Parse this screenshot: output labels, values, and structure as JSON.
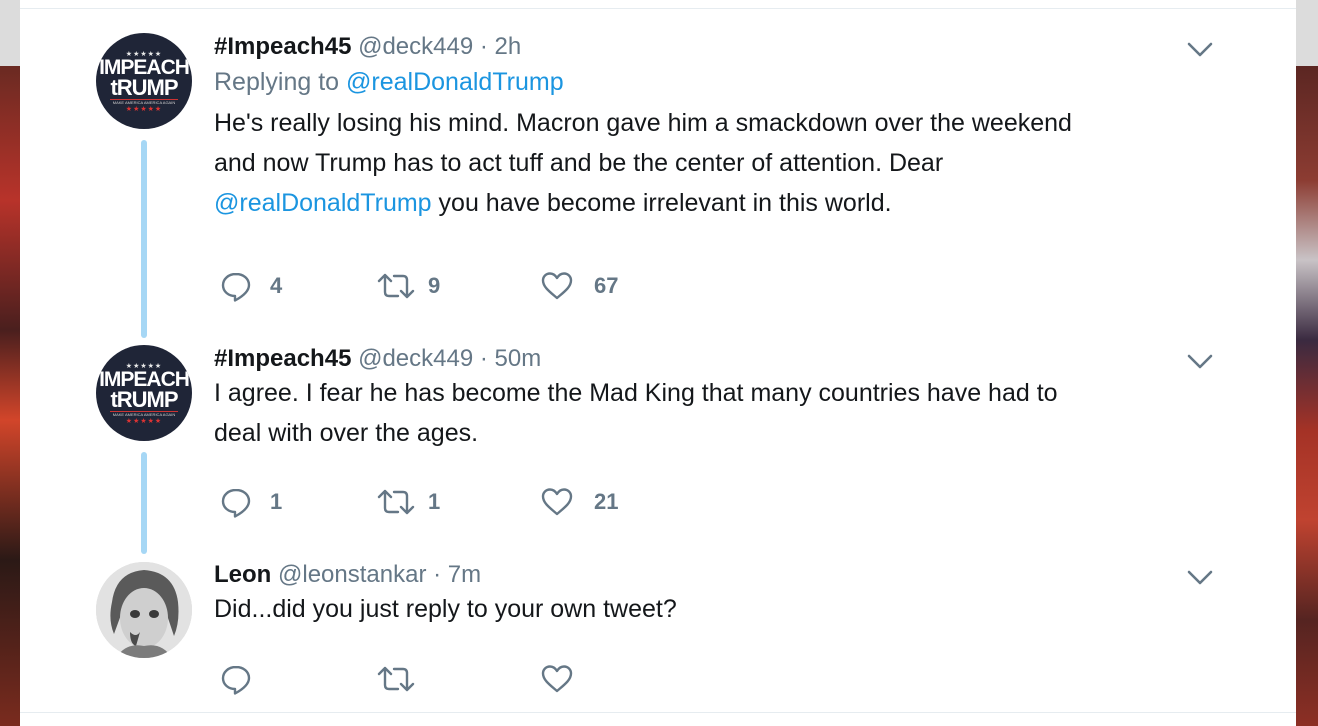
{
  "tweets": [
    {
      "name": "#Impeach45",
      "handle": "@deck449",
      "time": "· 2h",
      "replying_prefix": "Replying to",
      "replying_to": "@realDonaldTrump",
      "text_line1": "He's really losing his mind. Macron gave him a smackdown over the weekend",
      "text_line2": "and now Trump has to act tuff and be the center of attention. Dear",
      "text_line3_link": "@realDonaldTrump",
      "text_line3_rest": " you have become irrelevant in this world.",
      "replies": "4",
      "retweets": "9",
      "likes": "67",
      "avatar": {
        "stars": "★★★★★",
        "word1": "IMPEACH",
        "word2": "tRUMP",
        "small": "MAKE AMERICA AMERICA AGAIN"
      }
    },
    {
      "name": "#Impeach45",
      "handle": "@deck449",
      "time": "· 50m",
      "text_line1": "I agree. I fear he has become the Mad King that many countries have had to",
      "text_line2": "deal with over the ages.",
      "replies": "1",
      "retweets": "1",
      "likes": "21",
      "avatar": {
        "stars": "★★★★★",
        "word1": "IMPEACH",
        "word2": "tRUMP",
        "small": "MAKE AMERICA AMERICA AGAIN"
      }
    },
    {
      "name": "Leon",
      "handle": "@leonstankar",
      "time": "· 7m",
      "text_line1": "Did...did you just reply to your own tweet?",
      "replies": "",
      "retweets": "",
      "likes": ""
    }
  ],
  "icons": {
    "reply": "reply-icon",
    "retweet": "retweet-icon",
    "like": "heart-icon",
    "more": "chevron-down-icon"
  },
  "colors": {
    "link": "#1b95e0",
    "thread": "#a6d7f5",
    "secondary": "#657786",
    "primary": "#14171a"
  }
}
